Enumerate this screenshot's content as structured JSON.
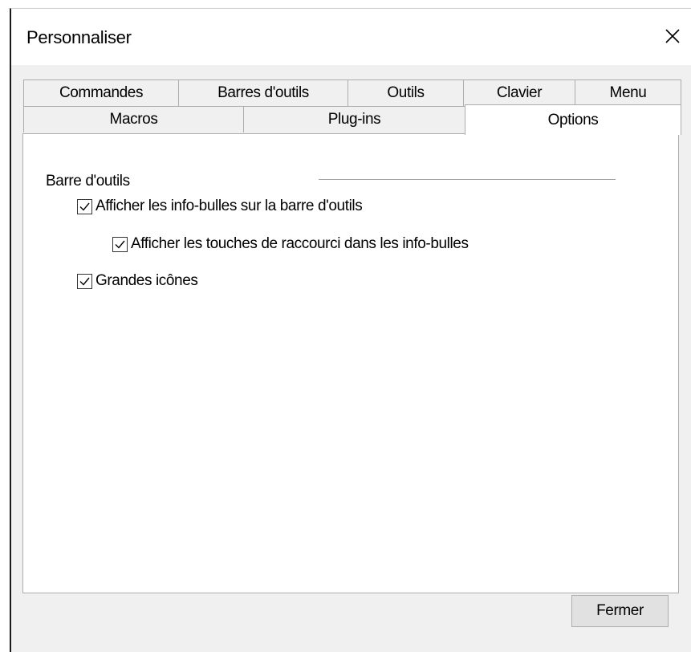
{
  "window": {
    "title": "Personnaliser",
    "close_icon": "close-icon"
  },
  "tabs": {
    "row1": [
      "Commandes",
      "Barres d'outils",
      "Outils",
      "Clavier",
      "Menu"
    ],
    "row2": [
      "Macros",
      "Plug-ins",
      "Options"
    ],
    "active": "Options"
  },
  "options": {
    "group_label": "Barre d'outils",
    "show_tooltips": {
      "label": "Afficher les info-bulles sur la barre d'outils",
      "checked": true
    },
    "show_shortcuts": {
      "label": "Afficher les touches de raccourci dans les info-bulles",
      "checked": true
    },
    "large_icons": {
      "label": "Grandes icônes",
      "checked": true
    }
  },
  "footer": {
    "close_label": "Fermer"
  }
}
